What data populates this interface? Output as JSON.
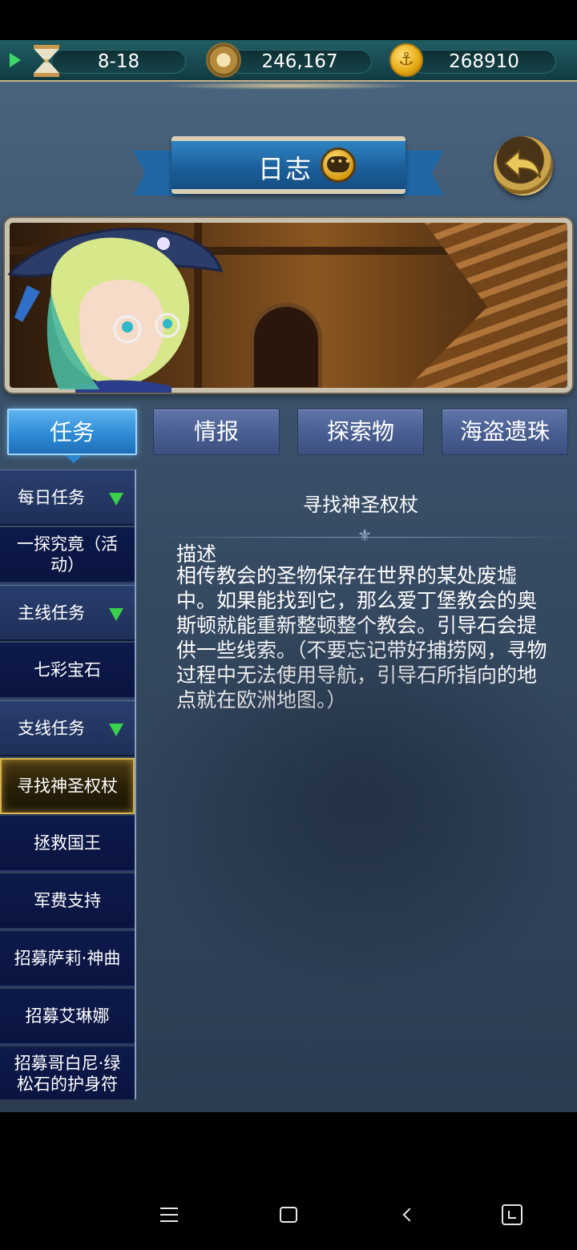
{
  "resources": {
    "stamina": "8-18",
    "exploration": "246,167",
    "gold": "268910",
    "icons": [
      "play-icon",
      "hourglass-icon",
      "compass-icon",
      "anchor-coin-icon"
    ]
  },
  "header": {
    "title": "日志",
    "title_icon": "chat-bubble-icon",
    "back_icon": "back-arrow-icon"
  },
  "tabs": [
    {
      "label": "任务",
      "active": true
    },
    {
      "label": "情报",
      "active": false
    },
    {
      "label": "探索物",
      "active": false
    },
    {
      "label": "海盗遗珠",
      "active": false
    }
  ],
  "sidebar": {
    "items": [
      {
        "label": "每日任务",
        "type": "header"
      },
      {
        "label": "一探究竟（活动）",
        "type": "entry"
      },
      {
        "label": "主线任务",
        "type": "header"
      },
      {
        "label": "七彩宝石",
        "type": "entry"
      },
      {
        "label": "支线任务",
        "type": "header"
      },
      {
        "label": "寻找神圣权杖",
        "type": "selected"
      },
      {
        "label": "拯救国王",
        "type": "entry"
      },
      {
        "label": "军费支持",
        "type": "entry"
      },
      {
        "label": "招募萨莉·神曲",
        "type": "entry"
      },
      {
        "label": "招募艾琳娜",
        "type": "entry"
      },
      {
        "label": "招募哥白尼·绿松石的护身符",
        "type": "entry"
      }
    ]
  },
  "detail": {
    "title": "寻找神圣权杖",
    "heading": "描述",
    "body": "相传教会的圣物保存在世界的某处废墟中。如果能找到它，那么爱丁堡教会的奥斯顿就能重新整顿整个教会。引导石会提供一些线索。（不要忘记带好捕捞网，寻物过程中无法使用导航，引导石所指向的地点就在欧洲地图。）"
  },
  "colors": {
    "tab_active": "#2d8bd6",
    "tab_normal": "#4a5f92",
    "arrow_green": "#3ad24a",
    "selected_border": "#d9b24a"
  }
}
